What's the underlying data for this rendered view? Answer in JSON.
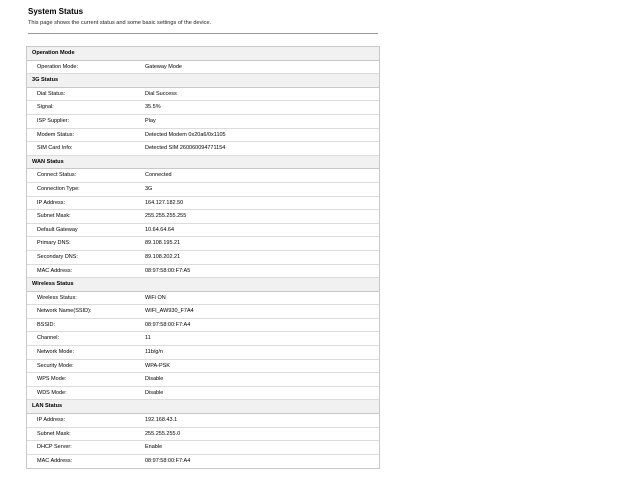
{
  "header": {
    "title": "System Status",
    "subtitle": "This page shows the current status and some basic settings of the device."
  },
  "sections": [
    {
      "title": "Operation Mode",
      "rows": [
        {
          "label": "Operation Mode:",
          "value": "Gateway Mode"
        }
      ]
    },
    {
      "title": "3G Status",
      "rows": [
        {
          "label": "Dial Status:",
          "value": "Dial Success"
        },
        {
          "label": "Signal:",
          "value": "35.5%"
        },
        {
          "label": "ISP Supplier:",
          "value": "Play"
        },
        {
          "label": "Modem Status:",
          "value": "Detected Modem  0x20a6/0x1105"
        },
        {
          "label": "SIM Card Info:",
          "value": "Detected SIM  260060094771154"
        }
      ]
    },
    {
      "title": "WAN Status",
      "rows": [
        {
          "label": "Connect Status:",
          "value": "Connected"
        },
        {
          "label": "Connection Type:",
          "value": "3G"
        },
        {
          "label": "IP Address:",
          "value": "164.127.182.50"
        },
        {
          "label": "Subnet Mask:",
          "value": "255.255.255.255"
        },
        {
          "label": "Default Gateway",
          "value": "10.64.64.64"
        },
        {
          "label": "Primary DNS:",
          "value": "89.108.195.21"
        },
        {
          "label": "Secondary DNS:",
          "value": "89.108.202.21"
        },
        {
          "label": "MAC Address:",
          "value": "08:97:58:00:F7:A5"
        }
      ]
    },
    {
      "title": "Wireless Status",
      "rows": [
        {
          "label": "Wireless Status:",
          "value": "WiFi ON"
        },
        {
          "label": "Network Name(SSID):",
          "value": "WIFI_AW930_F7A4"
        },
        {
          "label": "BSSID:",
          "value": "08:97:58:00:F7:A4"
        },
        {
          "label": "Channel:",
          "value": "11"
        },
        {
          "label": "Network Mode:",
          "value": "11b/g/n"
        },
        {
          "label": "Security Mode:",
          "value": "WPA-PSK"
        },
        {
          "label": "WPS Mode:",
          "value": "Disable"
        },
        {
          "label": "WDS Mode:",
          "value": "Disable"
        }
      ]
    },
    {
      "title": "LAN Status",
      "rows": [
        {
          "label": "IP Address:",
          "value": "192.168.43.1"
        },
        {
          "label": "Subnet Mask:",
          "value": "255.255.255.0"
        },
        {
          "label": "DHCP Server:",
          "value": "Enable"
        },
        {
          "label": "MAC Address:",
          "value": "08:97:58:00:F7:A4"
        }
      ]
    }
  ]
}
